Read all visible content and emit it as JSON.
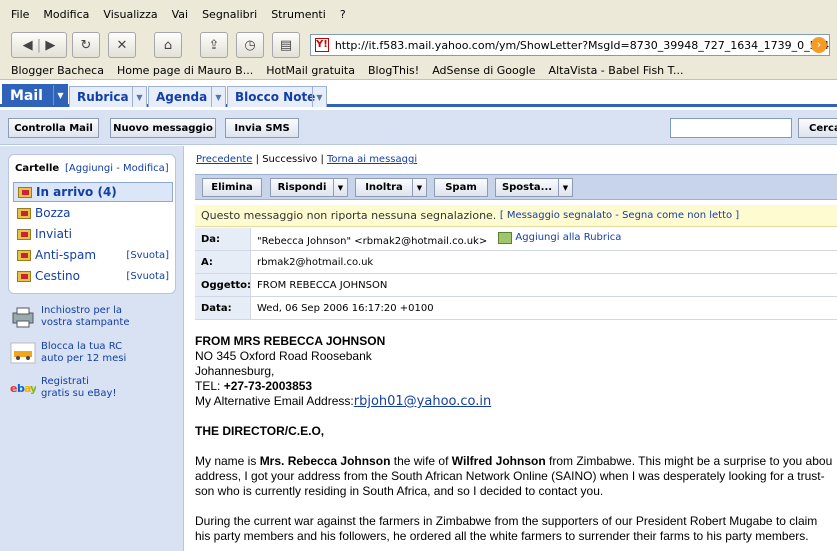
{
  "browser": {
    "menu": [
      "File",
      "Modifica",
      "Visualizza",
      "Vai",
      "Segnalibri",
      "Strumenti",
      "?"
    ],
    "url": "http://it.f583.mail.yahoo.com/ym/ShowLetter?MsgId=8730_39948_727_1634_1739_0_5_4974_5(",
    "bookmarks": [
      "Blogger Bacheca",
      "Home page di Mauro B...",
      "HotMail gratuita",
      "BlogThis!",
      "AdSense di Google",
      "AltaVista - Babel Fish T..."
    ]
  },
  "tabs": {
    "mail": "Mail",
    "rubrica": "Rubrica",
    "agenda": "Agenda",
    "blocco": "Blocco Note"
  },
  "actions": {
    "controlla": "Controlla Mail",
    "nuovo": "Nuovo messaggio",
    "sms": "Invia SMS",
    "cerca": "Cerca"
  },
  "sidebar": {
    "cartelle": "Cartelle",
    "manage": "[Aggiungi - Modifica]",
    "folders": [
      {
        "label": "In arrivo (4)",
        "action": ""
      },
      {
        "label": "Bozza",
        "action": ""
      },
      {
        "label": "Inviati",
        "action": ""
      },
      {
        "label": "Anti-spam",
        "action": "[Svuota]"
      },
      {
        "label": "Cestino",
        "action": "[Svuota]"
      }
    ],
    "promos": [
      {
        "line1": "Inchiostro per la",
        "line2": "vostra stampante"
      },
      {
        "line1": "Blocca la tua RC",
        "line2": "auto per 12 mesi"
      },
      {
        "line1": "Registrati",
        "line2": "gratis su eBay!"
      }
    ]
  },
  "message": {
    "nav": {
      "prev": "Precedente",
      "sep1": " | Successivo | ",
      "back": "Torna ai messaggi"
    },
    "toolbar": {
      "elimina": "Elimina",
      "rispondi": "Rispondi",
      "inoltra": "Inoltra",
      "spam": "Spam",
      "sposta": "Sposta..."
    },
    "notice": "Questo messaggio non riporta nessuna segnalazione.",
    "notice_link": "[ Messaggio segnalato - Segna come non letto ]",
    "headers": {
      "da_label": "Da:",
      "da_value": "\"Rebecca Johnson\" <rbmak2@hotmail.co.uk>",
      "add_rubrica": "Aggiungi alla Rubrica",
      "a_label": "A:",
      "a_value": "rbmak2@hotmail.co.uk",
      "oggetto_label": "Oggetto:",
      "oggetto_value": "FROM REBECCA JOHNSON",
      "data_label": "Data:",
      "data_value": "Wed, 06 Sep 2006 16:17:20 +0100"
    },
    "body": {
      "l1": "FROM MRS REBECCA JOHNSON",
      "l2": "NO 345 Oxford Road Roosebank",
      "l3": "Johannesburg,",
      "tel_label": "TEL: ",
      "tel": "+27-73-2003853",
      "alt_label": "My Alternative Email Address:",
      "alt_email": "rbjoh01@yahoo.co.in",
      "director": "THE DIRECTOR/C.E.O,",
      "p1a": "My name is ",
      "p1b": "Mrs. Rebecca Johnson",
      "p1c": " the wife of ",
      "p1d": "Wilfred Johnson",
      "p1e": " from Zimbabwe. This might be a surprise to you abou",
      "p1f": "address, I got your address from the South African Network Online (SAINO) when I was desperately looking for a trust-",
      "p1g": "son who is currently residing in South Africa, and so I decided to contact you.",
      "p2a": "During the current war against the farmers in Zimbabwe from the supporters of our President Robert Mugabe to claim",
      "p2b": "his party members and his followers, he ordered all the white farmers to surrender their farms to his party members."
    }
  }
}
